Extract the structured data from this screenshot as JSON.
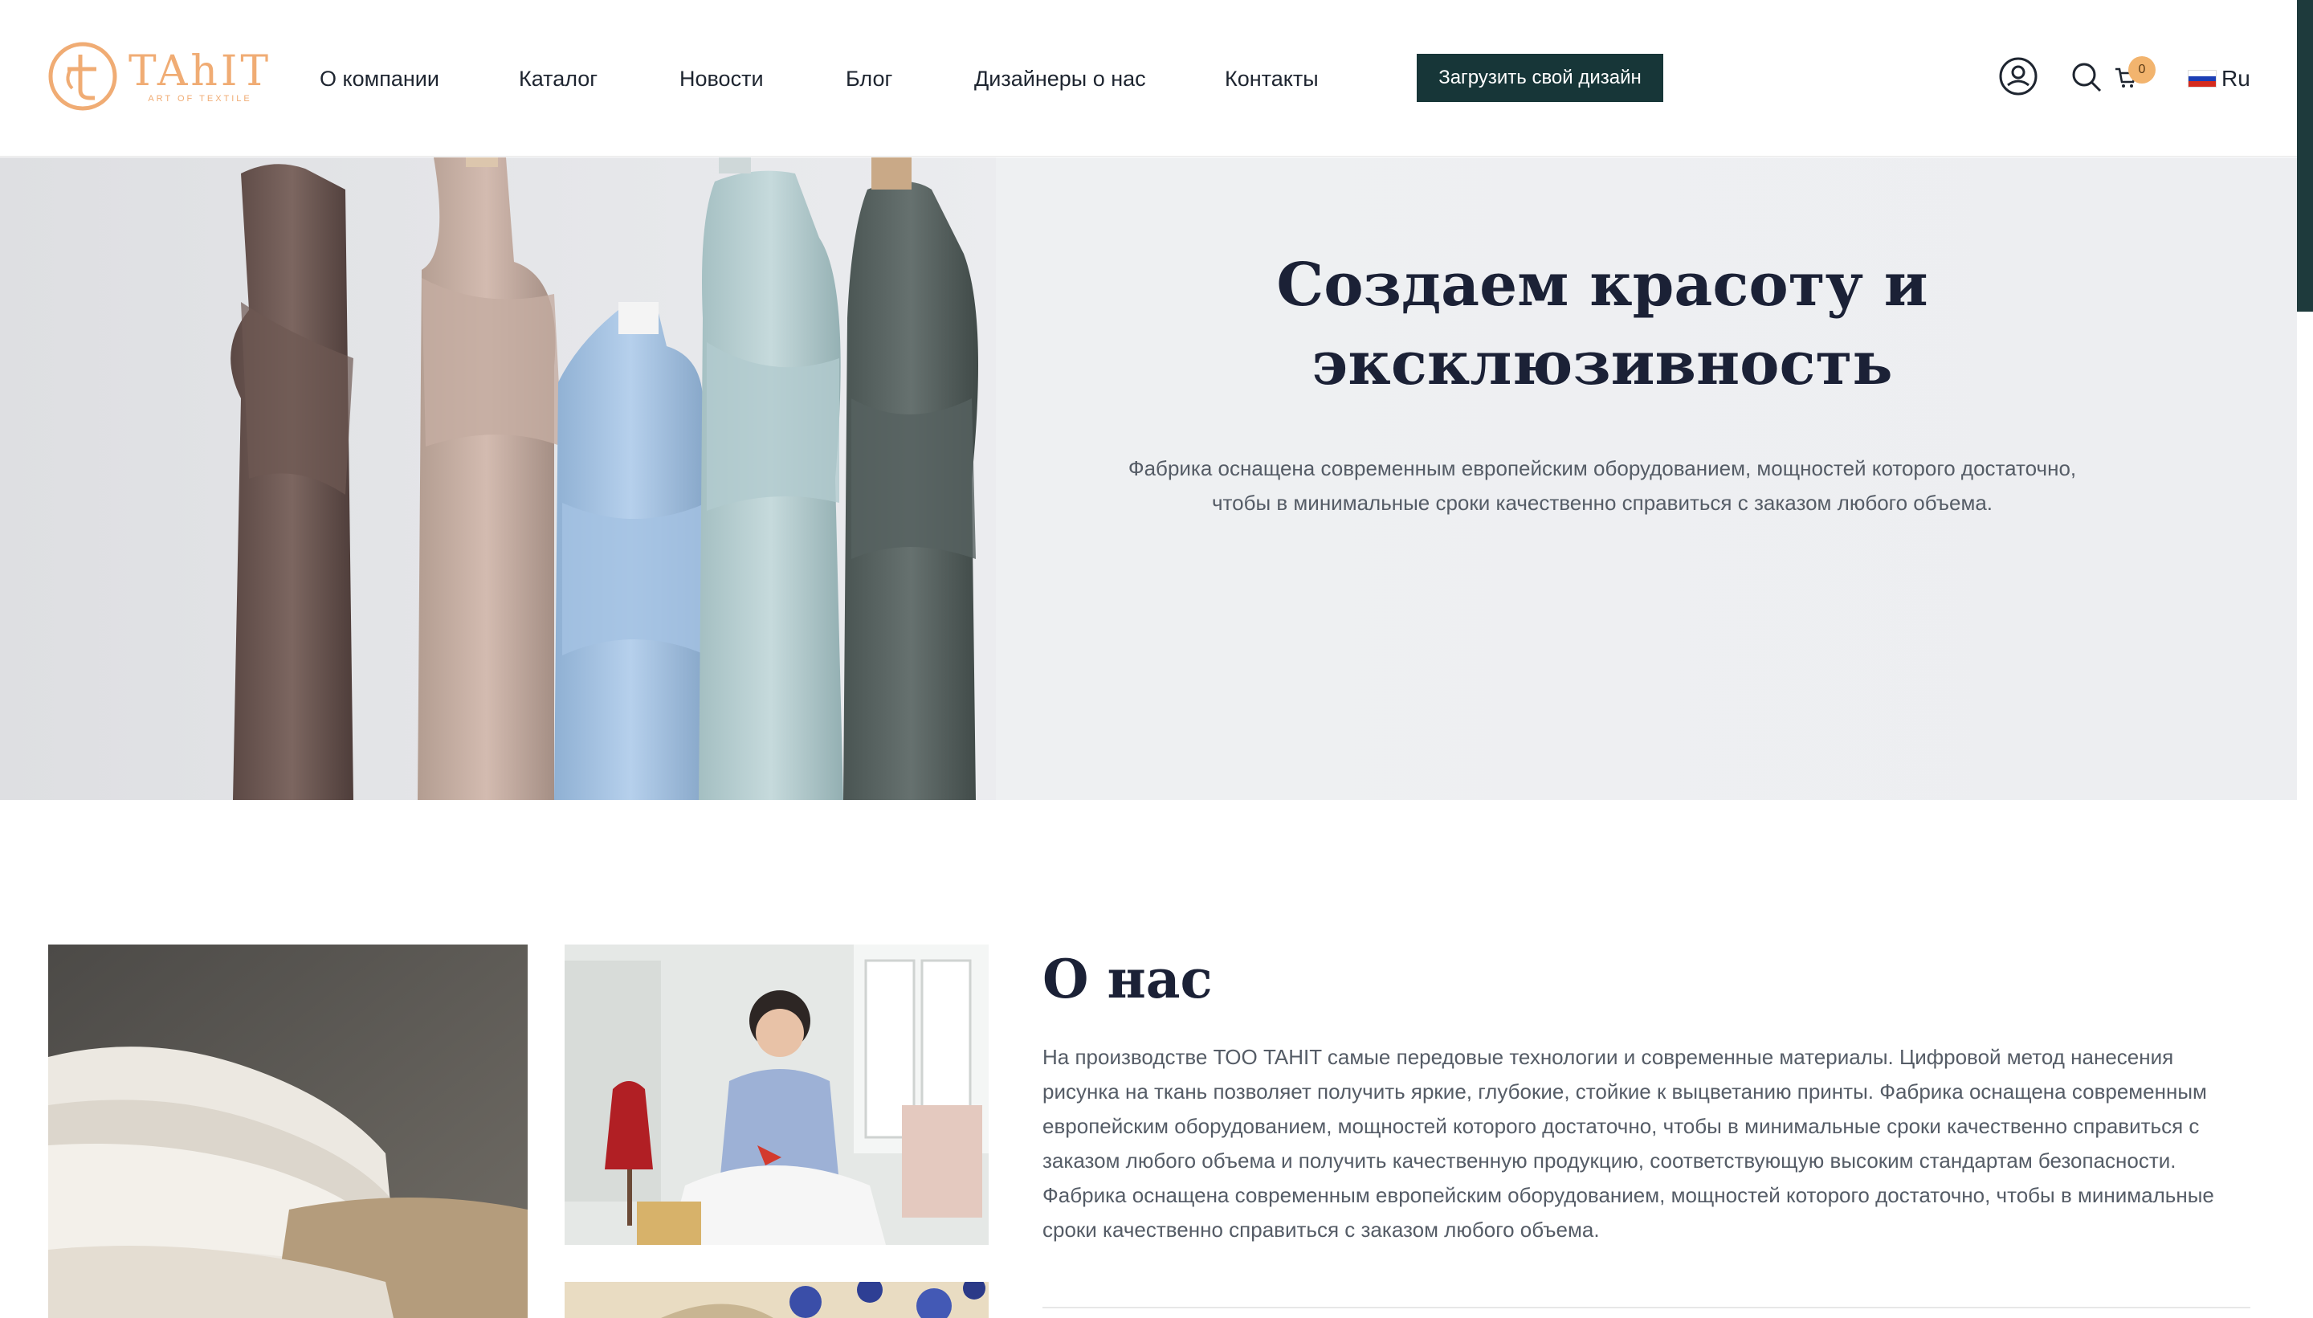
{
  "brand": {
    "logo_text": "TAhIT",
    "logo_subtitle": "ART OF TEXTILE",
    "accent_color": "#f0ac74",
    "primary_dark": "#173638"
  },
  "nav": {
    "items": [
      {
        "label": "О компании"
      },
      {
        "label": "Каталог"
      },
      {
        "label": "Новости"
      },
      {
        "label": "Блог"
      },
      {
        "label": "Дизайнеры о нас"
      },
      {
        "label": "Контакты"
      }
    ],
    "upload_button": "Загрузить свой дизайн"
  },
  "header_icons": {
    "account": "user-circle-icon",
    "search": "search-icon",
    "cart": "cart-icon",
    "cart_count": "0",
    "language": "Ru",
    "flag": "russia-flag-icon"
  },
  "hero": {
    "title_line1": "Создаем красоту и",
    "title_line2": "эксклюзивность",
    "text": "Фабрика оснащена современным европейским оборудованием, мощностей которого достаточно, чтобы в минимальные сроки качественно справиться с заказом любого объема.",
    "fabric_colors": [
      "#6f5a55",
      "#c9b0a4",
      "#a9c6e4",
      "#b9d0d3",
      "#5b6664"
    ]
  },
  "about": {
    "title": "О нас",
    "text": "На производстве ТОО TAHIT самые передовые технологии и современные материалы. Цифровой метод нанесения рисунка на ткань позволяет получить яркие, глубокие, стойкие к выцветанию принты. Фабрика оснащена современным европейским оборудованием, мощностей которого достаточно, чтобы в минимальные сроки качественно справиться с заказом любого объема и получить качественную продукцию, соответствующую высоким стандартам безопасности. Фабрика оснащена современным европейским оборудованием, мощностей которого достаточно, чтобы в минимальные сроки качественно справиться с заказом любого объема."
  }
}
